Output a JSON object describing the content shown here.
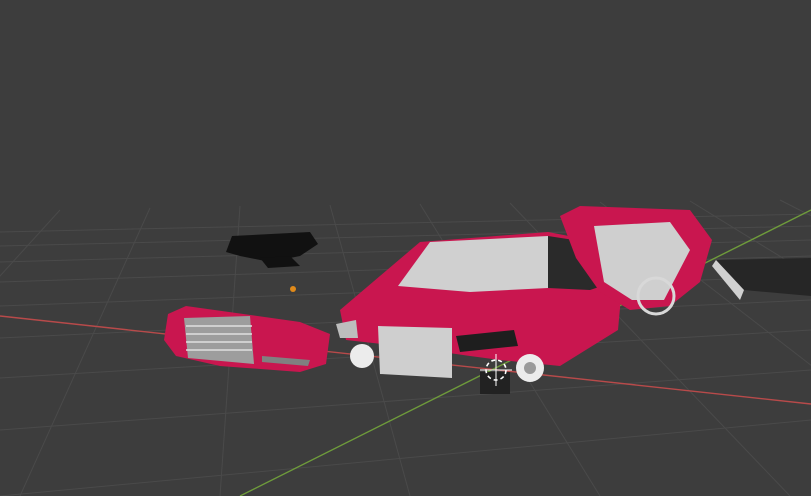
{
  "app": {
    "name": "3D viewport",
    "background_color": "#3d3d3d",
    "grid_color": "#4a4a4a",
    "x_axis_color": "#b84a4a",
    "y_axis_color": "#6e9b3b"
  },
  "scene": {
    "body_paint_color": "#c9164f",
    "interior_color": "#cfcfcf",
    "trim_color": "#2a2a2a",
    "objects": [
      {
        "name": "front-bumper",
        "type": "mesh",
        "selected": false
      },
      {
        "name": "car-body",
        "type": "mesh",
        "selected": false
      },
      {
        "name": "interior-shell",
        "type": "mesh",
        "selected": false
      },
      {
        "name": "side-panel",
        "type": "mesh",
        "selected": false
      },
      {
        "name": "scattered-fragments",
        "type": "mesh",
        "selected": false
      },
      {
        "name": "light",
        "type": "light",
        "selected": false
      },
      {
        "name": "3d-cursor",
        "type": "cursor",
        "selected": false
      }
    ]
  }
}
